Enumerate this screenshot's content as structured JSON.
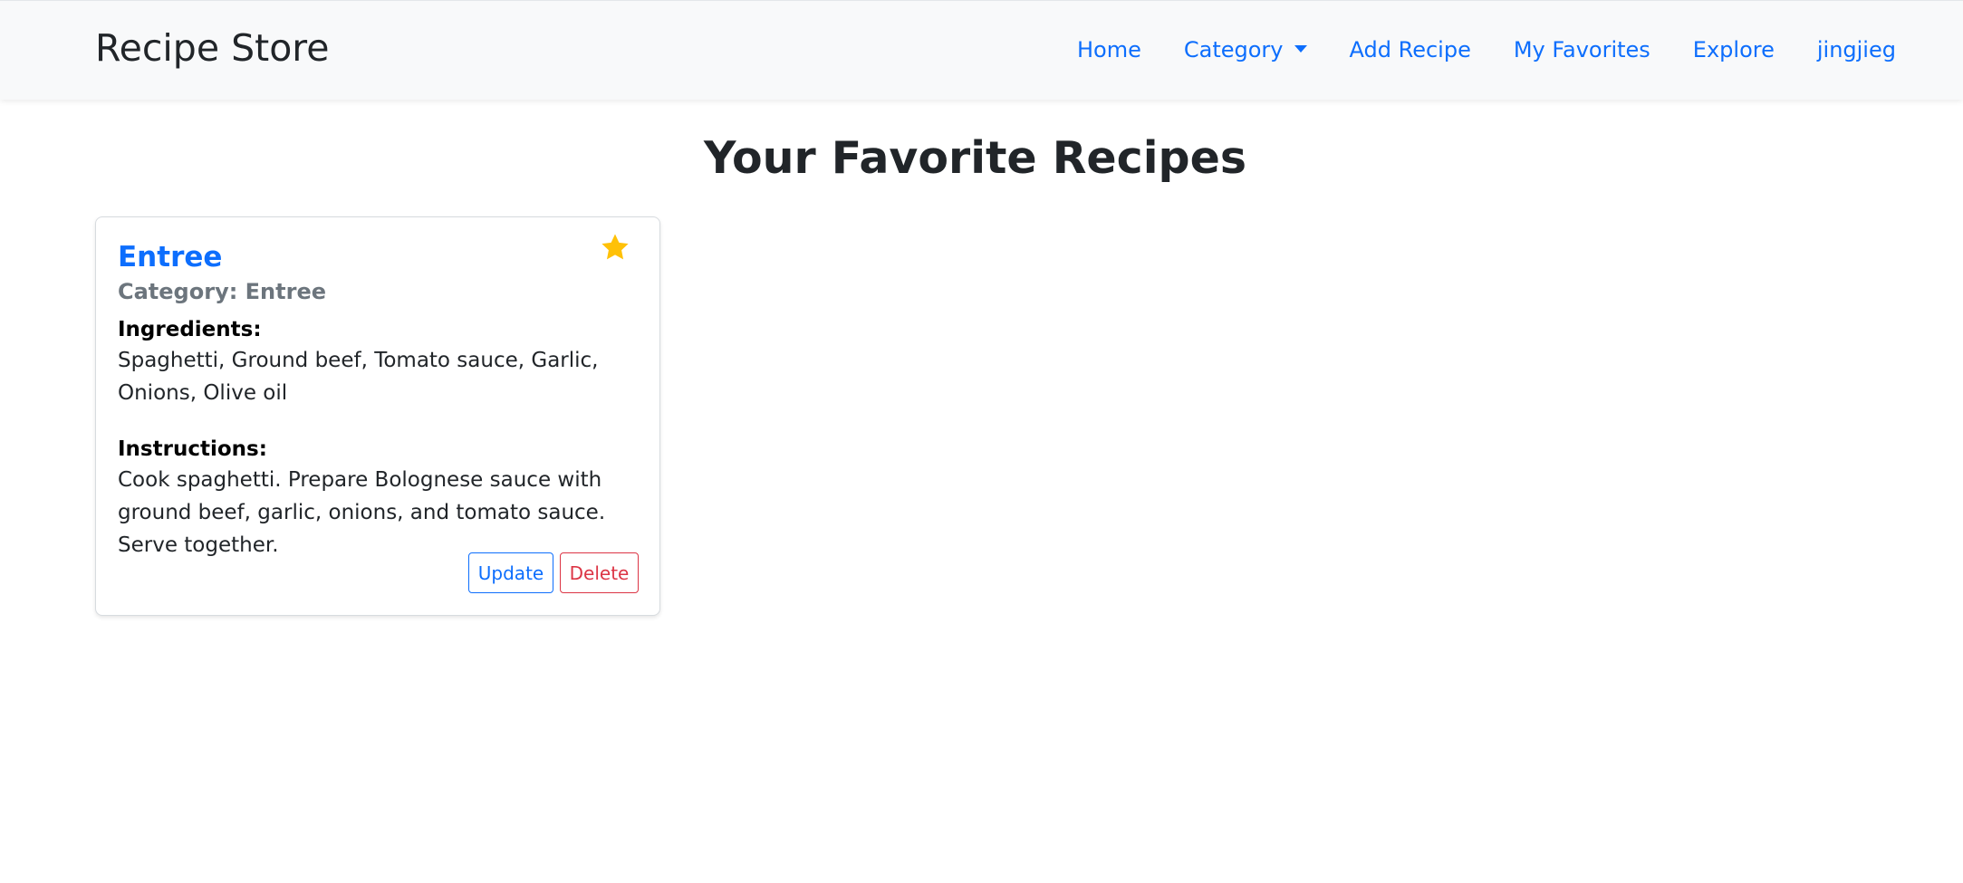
{
  "navbar": {
    "brand": "Recipe Store",
    "items": [
      {
        "label": "Home"
      },
      {
        "label": "Category"
      },
      {
        "label": "Add Recipe"
      },
      {
        "label": "My Favorites"
      },
      {
        "label": "Explore"
      },
      {
        "label": "jingjieg"
      }
    ]
  },
  "page": {
    "title": "Your Favorite Recipes"
  },
  "recipe": {
    "title": "Entree",
    "category": "Category: Entree",
    "ingredients_label": "Ingredients:",
    "ingredients": "Spaghetti, Ground beef, Tomato sauce, Garlic, Onions, Olive oil",
    "instructions_label": "Instructions:",
    "instructions": "Cook spaghetti. Prepare Bolognese sauce with ground beef, garlic, onions, and tomato sauce. Serve together.",
    "update_label": "Update",
    "delete_label": "Delete",
    "favorite": true
  },
  "colors": {
    "link": "#0d6efd",
    "navbar_bg": "#f8f9fa",
    "star": "#ffc107",
    "danger": "#dc3545",
    "muted": "#6c757d"
  },
  "icons": {
    "favorite": "star-icon",
    "dropdown": "caret-down-icon"
  }
}
